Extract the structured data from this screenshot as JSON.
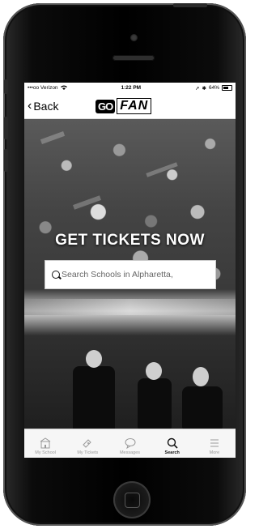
{
  "status_bar": {
    "carrier": "•••oo Verizon",
    "time": "1:22 PM",
    "battery": "64%"
  },
  "nav": {
    "back_label": "Back",
    "logo_go": "GO",
    "logo_fan": "FAN"
  },
  "hero": {
    "title": "GET TICKETS NOW"
  },
  "search": {
    "placeholder": "Search Schools in Alpharetta,"
  },
  "tabbar": {
    "items": [
      {
        "label": "My School",
        "icon": "school-icon"
      },
      {
        "label": "My Tickets",
        "icon": "ticket-icon"
      },
      {
        "label": "Messages",
        "icon": "messages-icon"
      },
      {
        "label": "Search",
        "icon": "search-icon",
        "active": true
      },
      {
        "label": "More",
        "icon": "menu-icon"
      }
    ]
  }
}
